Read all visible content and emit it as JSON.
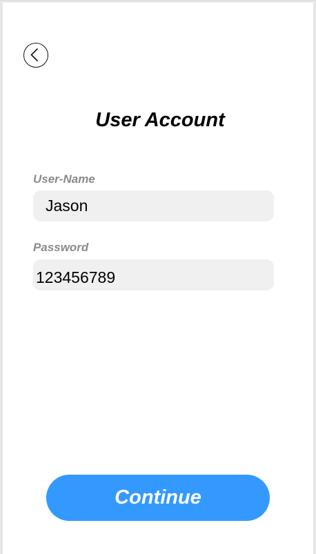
{
  "header": {
    "back_icon": "chevron-left-circle-icon",
    "title": "User Account"
  },
  "form": {
    "username": {
      "label": "User-Name",
      "value": "Jason"
    },
    "password": {
      "label": "Password",
      "value": "123456789"
    }
  },
  "actions": {
    "continue_label": "Continue"
  },
  "colors": {
    "accent": "#3399ff",
    "input_background": "#f0f0f0",
    "label": "#8a8a8a"
  }
}
